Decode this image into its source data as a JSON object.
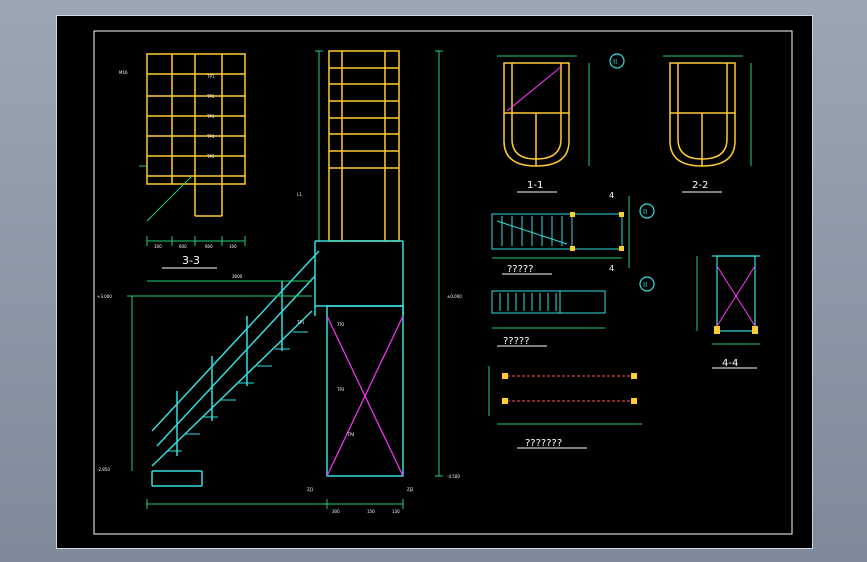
{
  "colors": {
    "background": "#000000",
    "frame": "#ffffff",
    "structure": "#ffcc33",
    "rail": "#33dddd",
    "bracing": "#ff33ff",
    "dimension": "#22cc77",
    "annotation": "#ffffff",
    "callout": "#ff5555"
  },
  "section_3_3": {
    "title": "3-3",
    "label_top_left": "M16",
    "dims": [
      "100",
      "600",
      "600",
      "100"
    ],
    "callouts": [
      "TP1",
      "TP2",
      "TP3",
      "TP4",
      "TP5"
    ]
  },
  "side_elevation": {
    "levels": [
      "+3.000",
      "±0.000",
      "-4.500",
      "-2.850"
    ],
    "dims": [
      "3000",
      "300",
      "150",
      "130"
    ],
    "callouts": [
      "TP1",
      "TP2",
      "TP3",
      "TP4",
      "L1",
      "ZJ1",
      "ZJ2"
    ]
  },
  "section_1_1": {
    "title": "1-1",
    "marker": "II"
  },
  "section_2_2": {
    "title": "2-2",
    "marker": "II"
  },
  "plan_a": {
    "title": "?????",
    "marker_top": "4",
    "marker_bottom": "4",
    "marker_circle": "II"
  },
  "plan_b": {
    "title": "?????",
    "marker_circle": "II"
  },
  "plan_c": {
    "title": "???????"
  },
  "section_4_4": {
    "title": "4-4"
  }
}
